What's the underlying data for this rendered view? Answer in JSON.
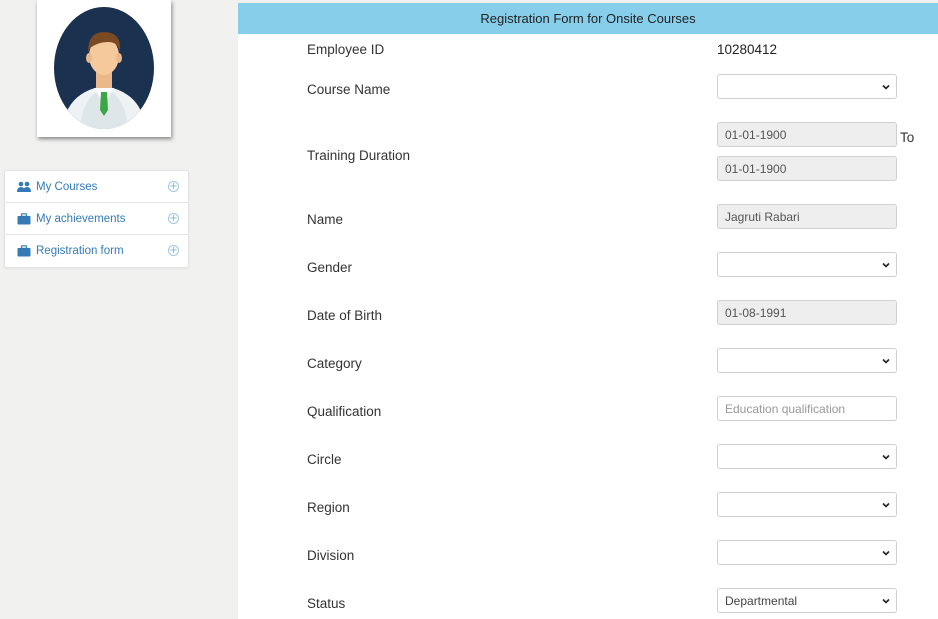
{
  "sidebar": {
    "items": [
      {
        "label": "My Courses",
        "icon": "users-icon"
      },
      {
        "label": "My achievements",
        "icon": "briefcase-icon"
      },
      {
        "label": "Registration form",
        "icon": "briefcase-icon"
      }
    ]
  },
  "form": {
    "title": "Registration Form for Onsite Courses",
    "employee_id": {
      "label": "Employee ID",
      "value": "10280412"
    },
    "course_name": {
      "label": "Course Name",
      "value": ""
    },
    "training_duration": {
      "label": "Training Duration",
      "from": "01-01-1900",
      "to_word": "To",
      "to": "01-01-1900"
    },
    "name": {
      "label": "Name",
      "value": "Jagruti Rabari"
    },
    "gender": {
      "label": "Gender",
      "value": ""
    },
    "dob": {
      "label": "Date of Birth",
      "value": "01-08-1991"
    },
    "category": {
      "label": "Category",
      "value": ""
    },
    "qualification": {
      "label": "Qualification",
      "placeholder": "Education qualification"
    },
    "circle": {
      "label": "Circle",
      "value": ""
    },
    "region": {
      "label": "Region",
      "value": ""
    },
    "division": {
      "label": "Division",
      "value": ""
    },
    "status": {
      "label": "Status",
      "value": "Departmental"
    }
  },
  "colors": {
    "header_bg": "#87ceeb",
    "link": "#337ab7",
    "avatar_bg": "#1b3150",
    "tie": "#3aa645"
  }
}
